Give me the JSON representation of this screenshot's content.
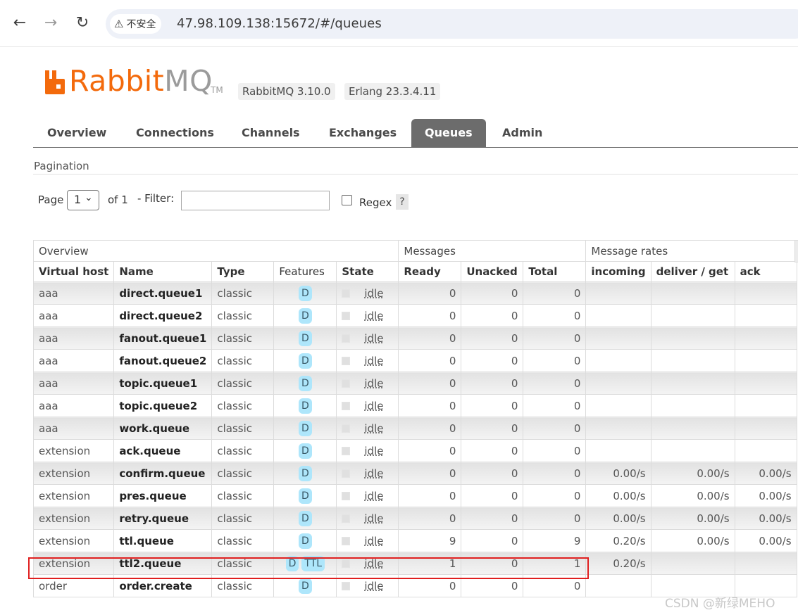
{
  "browser": {
    "security_label": "不安全",
    "url": "47.98.109.138:15672/#/queues"
  },
  "header": {
    "logo_rabbit": "Rabbit",
    "logo_mq": "MQ",
    "logo_tm": "TM",
    "rabbitmq_version": "RabbitMQ 3.10.0",
    "erlang_version": "Erlang 23.3.4.11",
    "brand_color": "#f36a0c"
  },
  "tabs": [
    "Overview",
    "Connections",
    "Channels",
    "Exchanges",
    "Queues",
    "Admin"
  ],
  "active_tab": "Queues",
  "pagination": {
    "title": "Pagination",
    "page_label": "Page",
    "page_value": "1",
    "of_label": "of 1",
    "filter_label": "- Filter:",
    "filter_value": "",
    "regex_label": "Regex",
    "regex_checked": false,
    "help_label": "?"
  },
  "table": {
    "groups": [
      "Overview",
      "Messages",
      "Message rates"
    ],
    "columns": [
      "Virtual host",
      "Name",
      "Type",
      "Features",
      "State",
      "Ready",
      "Unacked",
      "Total",
      "incoming",
      "deliver / get",
      "ack"
    ],
    "rows": [
      {
        "vhost": "aaa",
        "name": "direct.queue1",
        "type": "classic",
        "features": [
          "D"
        ],
        "state": "idle",
        "ready": "0",
        "unacked": "0",
        "total": "0",
        "incoming": "",
        "deliver": "",
        "ack": ""
      },
      {
        "vhost": "aaa",
        "name": "direct.queue2",
        "type": "classic",
        "features": [
          "D"
        ],
        "state": "idle",
        "ready": "0",
        "unacked": "0",
        "total": "0",
        "incoming": "",
        "deliver": "",
        "ack": ""
      },
      {
        "vhost": "aaa",
        "name": "fanout.queue1",
        "type": "classic",
        "features": [
          "D"
        ],
        "state": "idle",
        "ready": "0",
        "unacked": "0",
        "total": "0",
        "incoming": "",
        "deliver": "",
        "ack": ""
      },
      {
        "vhost": "aaa",
        "name": "fanout.queue2",
        "type": "classic",
        "features": [
          "D"
        ],
        "state": "idle",
        "ready": "0",
        "unacked": "0",
        "total": "0",
        "incoming": "",
        "deliver": "",
        "ack": ""
      },
      {
        "vhost": "aaa",
        "name": "topic.queue1",
        "type": "classic",
        "features": [
          "D"
        ],
        "state": "idle",
        "ready": "0",
        "unacked": "0",
        "total": "0",
        "incoming": "",
        "deliver": "",
        "ack": ""
      },
      {
        "vhost": "aaa",
        "name": "topic.queue2",
        "type": "classic",
        "features": [
          "D"
        ],
        "state": "idle",
        "ready": "0",
        "unacked": "0",
        "total": "0",
        "incoming": "",
        "deliver": "",
        "ack": ""
      },
      {
        "vhost": "aaa",
        "name": "work.queue",
        "type": "classic",
        "features": [
          "D"
        ],
        "state": "idle",
        "ready": "0",
        "unacked": "0",
        "total": "0",
        "incoming": "",
        "deliver": "",
        "ack": ""
      },
      {
        "vhost": "extension",
        "name": "ack.queue",
        "type": "classic",
        "features": [
          "D"
        ],
        "state": "idle",
        "ready": "0",
        "unacked": "0",
        "total": "0",
        "incoming": "",
        "deliver": "",
        "ack": ""
      },
      {
        "vhost": "extension",
        "name": "confirm.queue",
        "type": "classic",
        "features": [
          "D"
        ],
        "state": "idle",
        "ready": "0",
        "unacked": "0",
        "total": "0",
        "incoming": "0.00/s",
        "deliver": "0.00/s",
        "ack": "0.00/s"
      },
      {
        "vhost": "extension",
        "name": "pres.queue",
        "type": "classic",
        "features": [
          "D"
        ],
        "state": "idle",
        "ready": "0",
        "unacked": "0",
        "total": "0",
        "incoming": "0.00/s",
        "deliver": "0.00/s",
        "ack": "0.00/s"
      },
      {
        "vhost": "extension",
        "name": "retry.queue",
        "type": "classic",
        "features": [
          "D"
        ],
        "state": "idle",
        "ready": "0",
        "unacked": "0",
        "total": "0",
        "incoming": "0.00/s",
        "deliver": "0.00/s",
        "ack": "0.00/s"
      },
      {
        "vhost": "extension",
        "name": "ttl.queue",
        "type": "classic",
        "features": [
          "D"
        ],
        "state": "idle",
        "ready": "9",
        "unacked": "0",
        "total": "9",
        "incoming": "0.20/s",
        "deliver": "0.00/s",
        "ack": "0.00/s"
      },
      {
        "vhost": "extension",
        "name": "ttl2.queue",
        "type": "classic",
        "features": [
          "D",
          "TTL"
        ],
        "state": "idle",
        "ready": "1",
        "unacked": "0",
        "total": "1",
        "incoming": "0.20/s",
        "deliver": "",
        "ack": ""
      },
      {
        "vhost": "order",
        "name": "order.create",
        "type": "classic",
        "features": [
          "D"
        ],
        "state": "idle",
        "ready": "0",
        "unacked": "0",
        "total": "0",
        "incoming": "",
        "deliver": "",
        "ack": ""
      }
    ]
  },
  "watermark": "CSDN @新绿MEHO",
  "highlight_color": "#e02020"
}
